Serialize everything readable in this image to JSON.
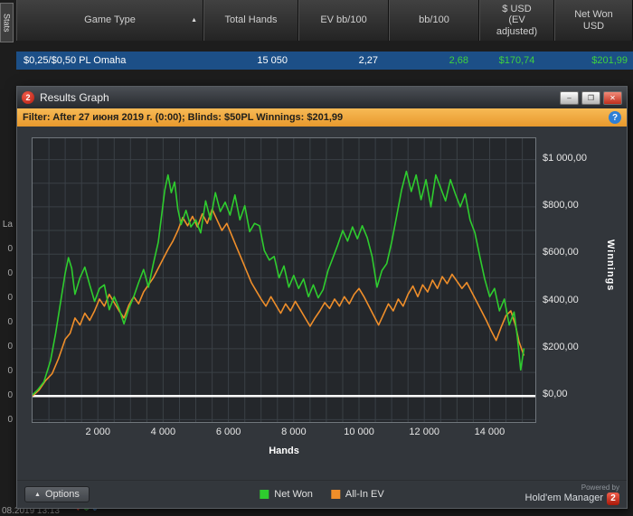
{
  "background_table": {
    "stats_tab": "Stats",
    "sort_icon": "▲",
    "columns": [
      {
        "label": "Game Type"
      },
      {
        "label": "Total Hands"
      },
      {
        "label": "EV bb/100"
      },
      {
        "label": "bb/100"
      },
      {
        "label": "$ USD (EV adjusted)"
      },
      {
        "label": "Net Won USD"
      }
    ],
    "row": {
      "game_type": "$0,25/$0,50 PL Omaha",
      "total_hands": "15 050",
      "ev_bb100": "2,27",
      "bb100": "2,68",
      "usd_ev_adjusted": "$170,74",
      "net_won_usd": "$201,99"
    },
    "left_fragments": [
      "La",
      "0",
      "0",
      "0",
      "0",
      "0",
      "0",
      "0",
      "0"
    ],
    "bottom_timestamp": "08.2019 13:13",
    "bottom_icons": [
      {
        "glyph": "♦",
        "color": "#d23b2f"
      },
      {
        "glyph": "♣",
        "color": "#3fae3f"
      },
      {
        "glyph": "♠",
        "color": "#4a8fd4"
      }
    ]
  },
  "dialog": {
    "title": "Results Graph",
    "logo": "2",
    "window_buttons": {
      "minimize": "–",
      "maximize": "❐",
      "close": "✕"
    },
    "filter": {
      "text": "Filter: After 27 июня 2019 г. (0:00); Blinds: $50PL Winnings: $201,99",
      "info_icon": "?"
    },
    "options_button": {
      "icon": "▲",
      "label": "Options"
    },
    "powered_by": {
      "line1": "Powered by",
      "line2": "Hold'em Manager",
      "logo": "2"
    }
  },
  "chart_data": {
    "type": "line",
    "title": "",
    "xlabel": "Hands",
    "ylabel": "Winnings",
    "xlim": [
      0,
      15400
    ],
    "ylim": [
      -110,
      1090
    ],
    "zero_line": 0,
    "grid": {
      "x_step": 500,
      "y_step": 100,
      "color": "#3a4046"
    },
    "x_ticks": [
      {
        "v": 2000,
        "label": "2 000"
      },
      {
        "v": 4000,
        "label": "4 000"
      },
      {
        "v": 6000,
        "label": "6 000"
      },
      {
        "v": 8000,
        "label": "8 000"
      },
      {
        "v": 10000,
        "label": "10 000"
      },
      {
        "v": 12000,
        "label": "12 000"
      },
      {
        "v": 14000,
        "label": "14 000"
      }
    ],
    "y_ticks": [
      {
        "v": 0,
        "label": "$0,00"
      },
      {
        "v": 200,
        "label": "$200,00"
      },
      {
        "v": 400,
        "label": "$400,00"
      },
      {
        "v": 600,
        "label": "$600,00"
      },
      {
        "v": 800,
        "label": "$800,00"
      },
      {
        "v": 1000,
        "label": "$1 000,00"
      }
    ],
    "series": [
      {
        "name": "Net Won",
        "color": "#2ecc2e",
        "final_value": 201.99,
        "points": [
          [
            0,
            5
          ],
          [
            150,
            25
          ],
          [
            350,
            60
          ],
          [
            550,
            150
          ],
          [
            700,
            260
          ],
          [
            850,
            390
          ],
          [
            1000,
            520
          ],
          [
            1100,
            585
          ],
          [
            1200,
            540
          ],
          [
            1300,
            430
          ],
          [
            1450,
            500
          ],
          [
            1600,
            545
          ],
          [
            1750,
            470
          ],
          [
            1900,
            400
          ],
          [
            2050,
            455
          ],
          [
            2200,
            470
          ],
          [
            2350,
            365
          ],
          [
            2500,
            420
          ],
          [
            2650,
            370
          ],
          [
            2800,
            305
          ],
          [
            2950,
            370
          ],
          [
            3100,
            420
          ],
          [
            3250,
            480
          ],
          [
            3400,
            535
          ],
          [
            3550,
            460
          ],
          [
            3700,
            560
          ],
          [
            3850,
            650
          ],
          [
            3950,
            760
          ],
          [
            4050,
            870
          ],
          [
            4150,
            935
          ],
          [
            4250,
            860
          ],
          [
            4350,
            905
          ],
          [
            4450,
            790
          ],
          [
            4550,
            725
          ],
          [
            4700,
            785
          ],
          [
            4850,
            715
          ],
          [
            5000,
            745
          ],
          [
            5150,
            690
          ],
          [
            5300,
            825
          ],
          [
            5450,
            745
          ],
          [
            5600,
            860
          ],
          [
            5750,
            780
          ],
          [
            5900,
            820
          ],
          [
            6050,
            765
          ],
          [
            6200,
            850
          ],
          [
            6350,
            745
          ],
          [
            6500,
            805
          ],
          [
            6650,
            695
          ],
          [
            6800,
            730
          ],
          [
            6950,
            720
          ],
          [
            7100,
            615
          ],
          [
            7250,
            575
          ],
          [
            7400,
            590
          ],
          [
            7550,
            500
          ],
          [
            7700,
            550
          ],
          [
            7850,
            460
          ],
          [
            8000,
            510
          ],
          [
            8150,
            455
          ],
          [
            8300,
            495
          ],
          [
            8450,
            420
          ],
          [
            8600,
            470
          ],
          [
            8750,
            415
          ],
          [
            8900,
            450
          ],
          [
            9050,
            530
          ],
          [
            9200,
            585
          ],
          [
            9350,
            640
          ],
          [
            9500,
            700
          ],
          [
            9650,
            655
          ],
          [
            9800,
            715
          ],
          [
            9950,
            665
          ],
          [
            10100,
            720
          ],
          [
            10250,
            670
          ],
          [
            10400,
            590
          ],
          [
            10550,
            460
          ],
          [
            10700,
            530
          ],
          [
            10850,
            560
          ],
          [
            11000,
            650
          ],
          [
            11150,
            760
          ],
          [
            11300,
            870
          ],
          [
            11450,
            950
          ],
          [
            11600,
            865
          ],
          [
            11750,
            935
          ],
          [
            11900,
            830
          ],
          [
            12050,
            915
          ],
          [
            12200,
            800
          ],
          [
            12350,
            935
          ],
          [
            12500,
            880
          ],
          [
            12650,
            825
          ],
          [
            12800,
            915
          ],
          [
            12950,
            855
          ],
          [
            13100,
            800
          ],
          [
            13250,
            855
          ],
          [
            13400,
            745
          ],
          [
            13550,
            690
          ],
          [
            13700,
            590
          ],
          [
            13850,
            495
          ],
          [
            14000,
            420
          ],
          [
            14150,
            455
          ],
          [
            14300,
            360
          ],
          [
            14450,
            410
          ],
          [
            14600,
            300
          ],
          [
            14750,
            355
          ],
          [
            14850,
            250
          ],
          [
            14950,
            110
          ],
          [
            15050,
            202
          ]
        ]
      },
      {
        "name": "All-In EV",
        "color": "#ef8e2a",
        "final_value": 170.74,
        "points": [
          [
            0,
            0
          ],
          [
            200,
            25
          ],
          [
            400,
            65
          ],
          [
            600,
            95
          ],
          [
            800,
            160
          ],
          [
            1000,
            240
          ],
          [
            1150,
            265
          ],
          [
            1300,
            330
          ],
          [
            1450,
            300
          ],
          [
            1600,
            350
          ],
          [
            1750,
            320
          ],
          [
            1900,
            360
          ],
          [
            2050,
            410
          ],
          [
            2200,
            380
          ],
          [
            2350,
            430
          ],
          [
            2500,
            395
          ],
          [
            2650,
            360
          ],
          [
            2800,
            330
          ],
          [
            2950,
            385
          ],
          [
            3100,
            420
          ],
          [
            3250,
            390
          ],
          [
            3400,
            440
          ],
          [
            3550,
            470
          ],
          [
            3700,
            500
          ],
          [
            3850,
            540
          ],
          [
            4000,
            580
          ],
          [
            4150,
            620
          ],
          [
            4300,
            655
          ],
          [
            4450,
            700
          ],
          [
            4600,
            755
          ],
          [
            4750,
            720
          ],
          [
            4900,
            760
          ],
          [
            5050,
            715
          ],
          [
            5200,
            770
          ],
          [
            5350,
            730
          ],
          [
            5500,
            790
          ],
          [
            5650,
            745
          ],
          [
            5800,
            700
          ],
          [
            5950,
            730
          ],
          [
            6100,
            680
          ],
          [
            6250,
            630
          ],
          [
            6400,
            580
          ],
          [
            6550,
            530
          ],
          [
            6700,
            480
          ],
          [
            6850,
            445
          ],
          [
            7000,
            410
          ],
          [
            7150,
            380
          ],
          [
            7300,
            420
          ],
          [
            7450,
            385
          ],
          [
            7600,
            350
          ],
          [
            7750,
            390
          ],
          [
            7900,
            360
          ],
          [
            8050,
            400
          ],
          [
            8200,
            365
          ],
          [
            8350,
            330
          ],
          [
            8500,
            295
          ],
          [
            8650,
            330
          ],
          [
            8800,
            360
          ],
          [
            8950,
            395
          ],
          [
            9100,
            370
          ],
          [
            9250,
            410
          ],
          [
            9400,
            380
          ],
          [
            9550,
            420
          ],
          [
            9700,
            390
          ],
          [
            9850,
            430
          ],
          [
            10000,
            455
          ],
          [
            10150,
            420
          ],
          [
            10300,
            380
          ],
          [
            10450,
            340
          ],
          [
            10600,
            300
          ],
          [
            10750,
            345
          ],
          [
            10900,
            390
          ],
          [
            11050,
            360
          ],
          [
            11200,
            410
          ],
          [
            11350,
            380
          ],
          [
            11500,
            430
          ],
          [
            11650,
            465
          ],
          [
            11800,
            420
          ],
          [
            11950,
            470
          ],
          [
            12100,
            440
          ],
          [
            12250,
            490
          ],
          [
            12400,
            455
          ],
          [
            12550,
            505
          ],
          [
            12700,
            475
          ],
          [
            12850,
            515
          ],
          [
            13000,
            485
          ],
          [
            13150,
            455
          ],
          [
            13300,
            480
          ],
          [
            13450,
            440
          ],
          [
            13600,
            400
          ],
          [
            13750,
            360
          ],
          [
            13900,
            320
          ],
          [
            14050,
            275
          ],
          [
            14200,
            235
          ],
          [
            14350,
            290
          ],
          [
            14500,
            340
          ],
          [
            14650,
            360
          ],
          [
            14800,
            295
          ],
          [
            14900,
            230
          ],
          [
            15050,
            171
          ]
        ]
      }
    ]
  }
}
